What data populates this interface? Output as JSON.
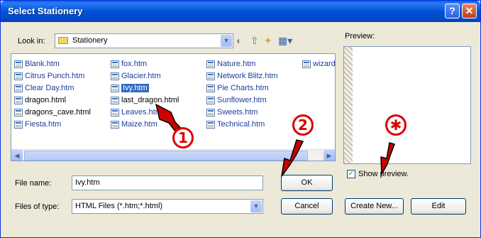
{
  "window": {
    "title": "Select Stationery"
  },
  "titlebar": {
    "help_label": "?",
    "close_label": "✕"
  },
  "lookin": {
    "label": "Look in:",
    "value": "Stationery"
  },
  "preview": {
    "label": "Preview:"
  },
  "files": {
    "columns": [
      [
        "Blank.htm",
        "Citrus Punch.htm",
        "Clear Day.htm",
        "dragon.html",
        "dragons_cave.html",
        "Fiesta.htm"
      ],
      [
        "fox.htm",
        "Glacier.htm",
        "Ivy.htm",
        "last_dragon.html",
        "Leaves.htm",
        "Maize.htm"
      ],
      [
        "Nature.htm",
        "Network Blitz.htm",
        "Pie Charts.htm",
        "Sunflower.htm",
        "Sweets.htm",
        "Technical.htm"
      ],
      [
        "wizard.htm"
      ]
    ],
    "selected": "Ivy.htm"
  },
  "filename": {
    "label": "File name:",
    "value": "Ivy.htm"
  },
  "filetype": {
    "label": "Files of type:",
    "value": "HTML Files (*.htm;*.html)"
  },
  "buttons": {
    "ok": "OK",
    "cancel": "Cancel",
    "create_new": "Create New...",
    "edit": "Edit"
  },
  "show_preview": {
    "label": "Show preview.",
    "checked": true
  },
  "annotations": {
    "step1": "1",
    "step2": "2",
    "step3": "✱"
  },
  "icons": [
    "folder-icon",
    "back-icon",
    "up-folder-icon",
    "new-folder-icon",
    "view-menu-icon",
    "file-icon"
  ],
  "colors": {
    "title_bar": "#0052d6",
    "selection": "#316ac5",
    "annotation_red": "#dd0000"
  }
}
